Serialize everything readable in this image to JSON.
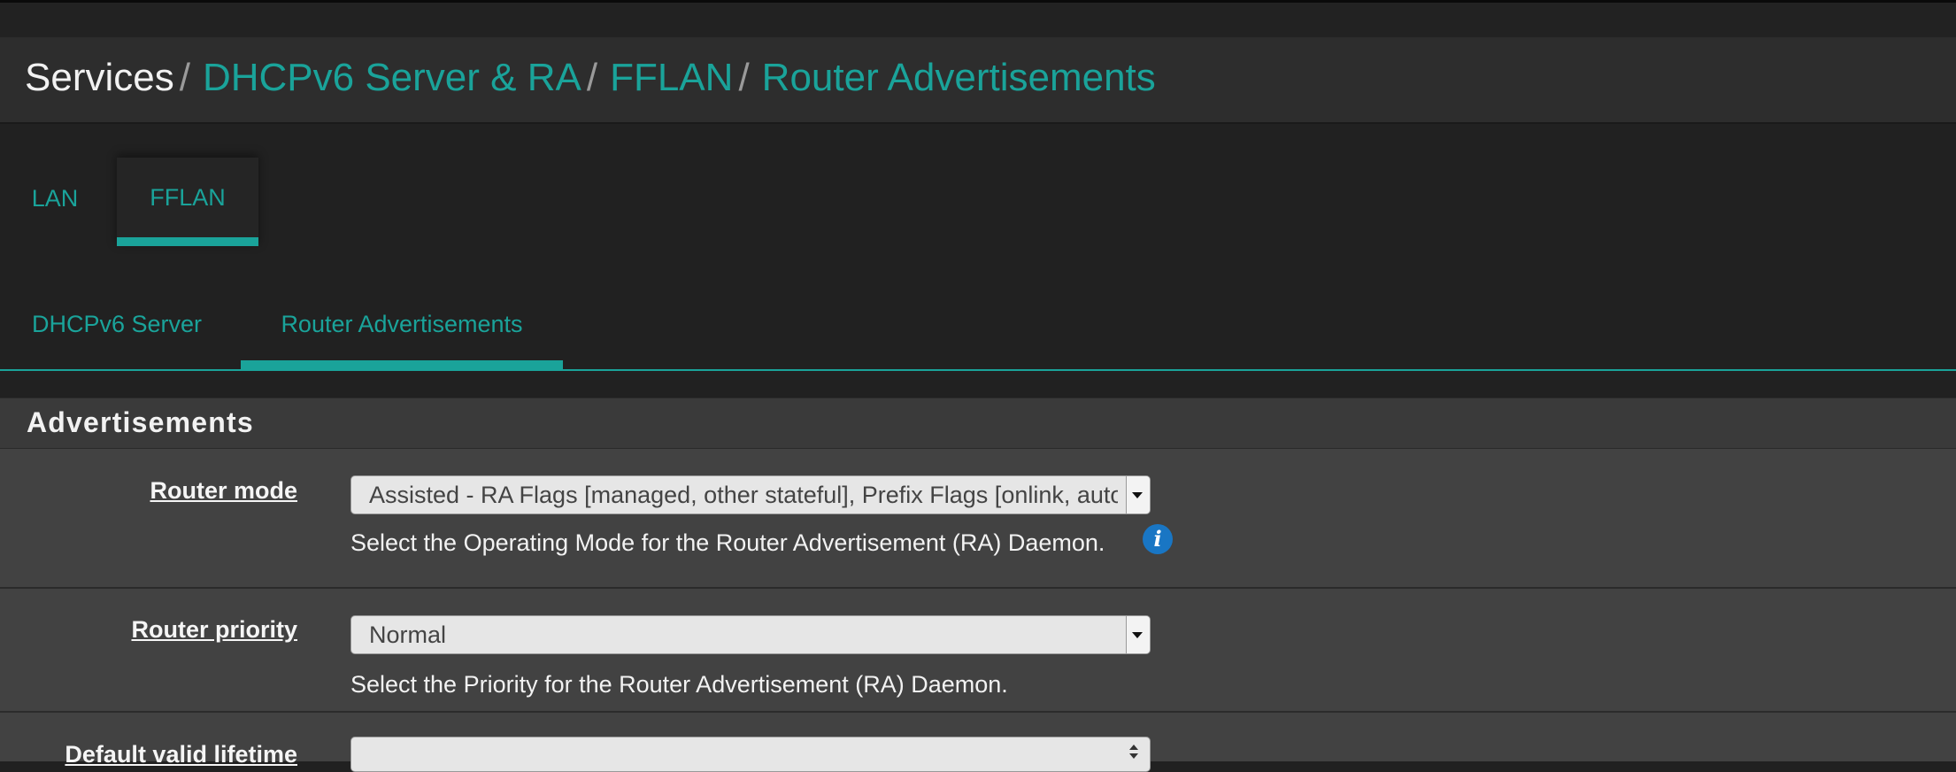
{
  "breadcrumb": {
    "items": [
      "Services",
      "DHCPv6 Server & RA",
      "FFLAN",
      "Router Advertisements"
    ],
    "separator": "/"
  },
  "interface_tabs": [
    {
      "label": "LAN",
      "active": false
    },
    {
      "label": "FFLAN",
      "active": true
    }
  ],
  "sub_tabs": [
    {
      "label": "DHCPv6 Server",
      "active": false
    },
    {
      "label": "Router Advertisements",
      "active": true
    }
  ],
  "section": {
    "title": "Advertisements"
  },
  "fields": {
    "router_mode": {
      "label": "Router mode",
      "value": "Assisted - RA Flags [managed, other stateful], Prefix Flags [onlink, auto, router]",
      "help": "Select the Operating Mode for the Router Advertisement (RA) Daemon."
    },
    "router_priority": {
      "label": "Router priority",
      "value": "Normal",
      "help": "Select the Priority for the Router Advertisement (RA) Daemon."
    },
    "default_valid_lifetime": {
      "label": "Default valid lifetime",
      "value": ""
    }
  },
  "colors": {
    "accent": "#1aa39a",
    "info": "#1976c4",
    "background": "#212121",
    "panel": "#424242"
  },
  "icons": {
    "info": "info-icon",
    "dropdown": "chevron-down-icon",
    "stepper": "spinner-arrows-icon"
  }
}
